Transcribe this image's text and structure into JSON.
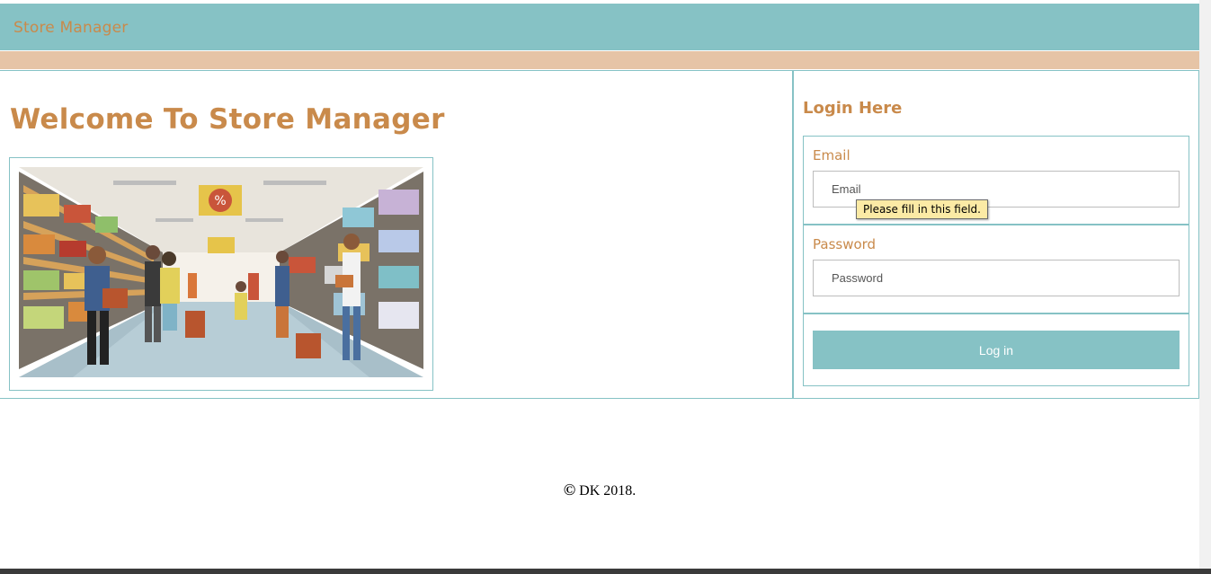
{
  "navbar": {
    "brand": "Store Manager",
    "color": "#86c2c5",
    "stripe_color": "#e6c4a6"
  },
  "main": {
    "heading": "Welcome To Store Manager",
    "image_icon": "supermarket-illustration"
  },
  "login": {
    "title": "Login Here",
    "email": {
      "label": "Email",
      "placeholder": "Email",
      "value": ""
    },
    "password": {
      "label": "Password",
      "placeholder": "Password",
      "value": ""
    },
    "submit_label": "Log in",
    "validation_tooltip": "Please fill in this field."
  },
  "footer": {
    "copyright_symbol": "©",
    "text": "DK 2018."
  },
  "colors": {
    "accent": "#86c2c5",
    "brand_text": "#c98a4b"
  }
}
